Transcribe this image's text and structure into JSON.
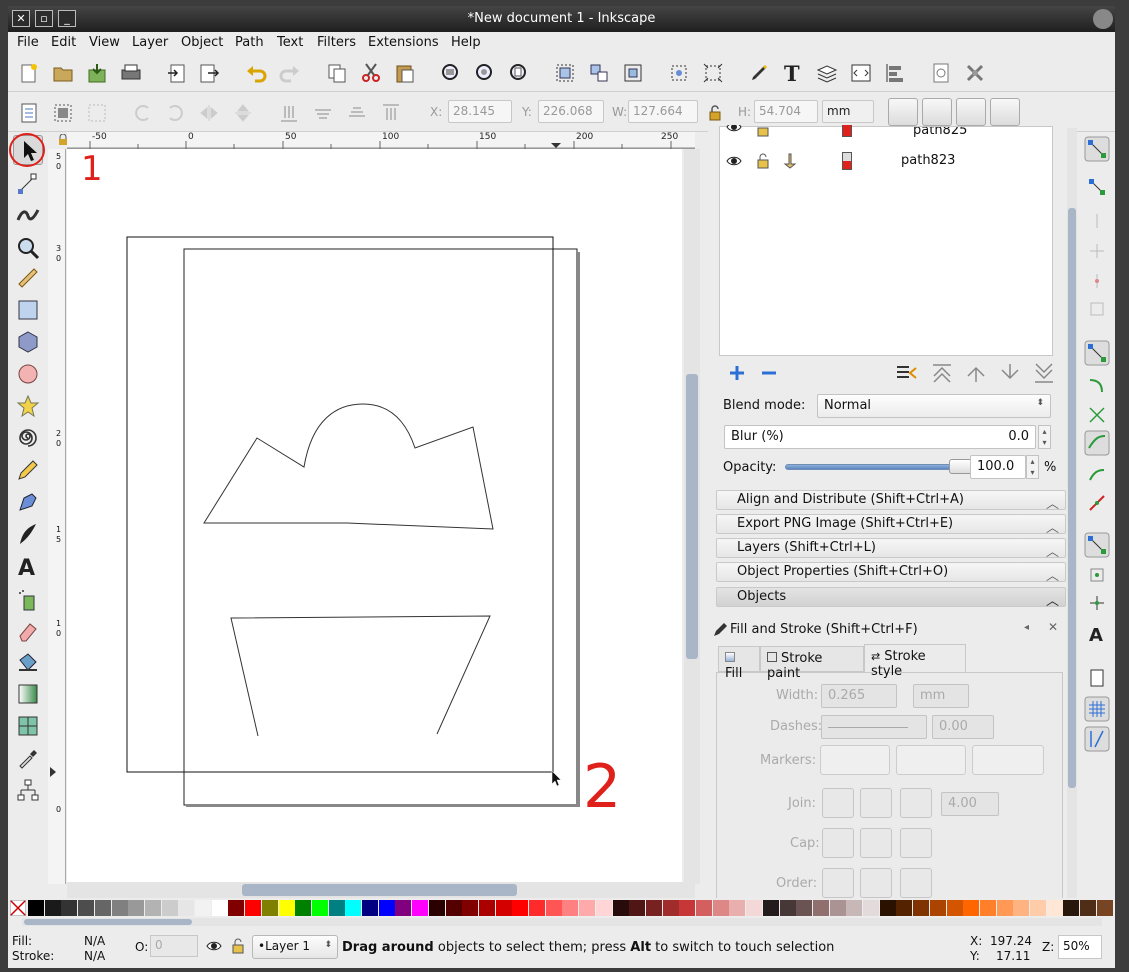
{
  "window": {
    "title": "*New document 1 - Inkscape"
  },
  "menu": [
    "File",
    "Edit",
    "View",
    "Layer",
    "Object",
    "Path",
    "Text",
    "Filters",
    "Extensions",
    "Help"
  ],
  "ctl": {
    "x_label": "X:",
    "x_val": "28.145",
    "y_label": "Y:",
    "y_val": "226.068",
    "w_label": "W:",
    "w_val": "127.664",
    "h_label": "H:",
    "h_val": "54.704",
    "unit": "mm"
  },
  "ruler": {
    "h_ticks": [
      "-50",
      "0",
      "50",
      "100",
      "150",
      "200",
      "250"
    ],
    "v_ticks": [
      "5",
      "0",
      "3",
      "0",
      "2",
      "0",
      "1",
      "5",
      "1",
      "0",
      "0"
    ]
  },
  "annot": {
    "one": "1",
    "two": "2"
  },
  "objects": {
    "rows": [
      "path825",
      "path823"
    ]
  },
  "blend": {
    "label": "Blend mode:",
    "value": "Normal"
  },
  "blur": {
    "label": "Blur (%)",
    "value": "0.0"
  },
  "opacity": {
    "label": "Opacity:",
    "value": "100.0",
    "unit": "%"
  },
  "panels": [
    "Align and Distribute (Shift+Ctrl+A)",
    "Export PNG Image (Shift+Ctrl+E)",
    "Layers (Shift+Ctrl+L)",
    "Object Properties (Shift+Ctrl+O)",
    "Objects"
  ],
  "fill_stroke": {
    "title": "Fill and Stroke (Shift+Ctrl+F)",
    "tabs": [
      "Fill",
      "Stroke paint",
      "Stroke style"
    ],
    "width_label": "Width:",
    "width_val": "0.265",
    "width_unit": "mm",
    "dashes_label": "Dashes:",
    "dashes_val": "0.00",
    "markers_label": "Markers:",
    "join_label": "Join:",
    "miter_val": "4.00",
    "cap_label": "Cap:",
    "order_label": "Order:"
  },
  "status": {
    "fill_label": "Fill:",
    "fill_val": "N/A",
    "stroke_label": "Stroke:",
    "stroke_val": "N/A",
    "o_label": "O:",
    "o_val": "0",
    "layer": "•Layer 1",
    "msg_b1": "Drag around",
    "msg_1": " objects to select them; press ",
    "msg_b2": "Alt",
    "msg_2": " to switch to touch selection",
    "x_label": "X:",
    "x_val": "197.24",
    "y_label": "Y:",
    "y_val": "17.11",
    "z_label": "Z:",
    "zoom": "50%"
  },
  "colors": {
    "annotation": "#e0201a",
    "accent": "#2b6fd6"
  }
}
